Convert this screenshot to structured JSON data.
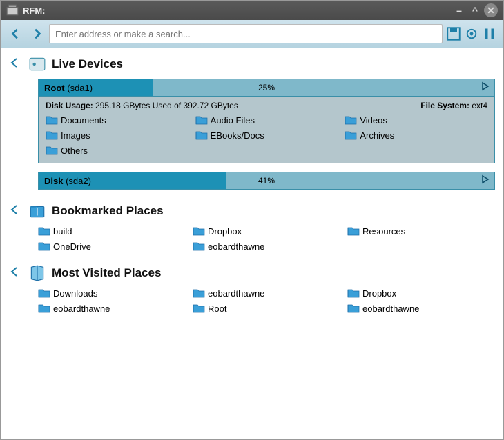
{
  "window": {
    "title": "RFM:"
  },
  "toolbar": {
    "search_placeholder": "Enter address or make a search..."
  },
  "sections": {
    "live_devices": {
      "title": "Live Devices",
      "devices": [
        {
          "name": "Root",
          "id": "(sda1)",
          "pct": "25%",
          "fill_width": "25%",
          "expanded": true,
          "usage_label": "Disk Usage:",
          "usage_text": "295.18 GBytes Used of 392.72 GBytes",
          "fs_label": "File System:",
          "fs_value": "ext4",
          "folders": [
            "Documents",
            "Audio Files",
            "Videos",
            "Images",
            "EBooks/Docs",
            "Archives",
            "Others"
          ]
        },
        {
          "name": "Disk",
          "id": "(sda2)",
          "pct": "41%",
          "fill_width": "41%",
          "expanded": false
        }
      ]
    },
    "bookmarked": {
      "title": "Bookmarked Places",
      "items": [
        "build",
        "Dropbox",
        "Resources",
        "OneDrive",
        "eobardthawne"
      ]
    },
    "most_visited": {
      "title": "Most Visited Places",
      "items": [
        "Downloads",
        "eobardthawne",
        "Dropbox",
        "eobardthawne",
        "Root",
        "eobardthawne"
      ]
    }
  }
}
